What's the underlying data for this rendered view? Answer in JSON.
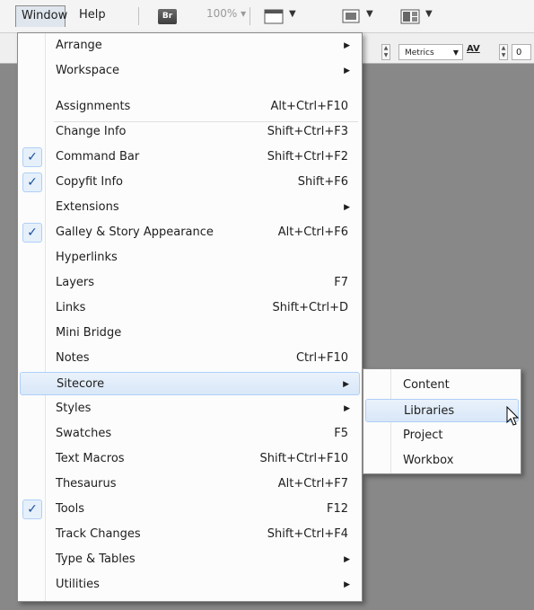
{
  "menubar": {
    "items": [
      {
        "label": "Window"
      },
      {
        "label": "Help"
      }
    ],
    "bridge_label": "Br",
    "zoom": "100%"
  },
  "controlbar": {
    "tracking_mode": "Metrics",
    "kern_label": "AV",
    "kern_value": "0"
  },
  "window_menu": {
    "items": [
      {
        "label": "Arrange",
        "shortcut": "",
        "submenu": true,
        "checked": false
      },
      {
        "label": "Workspace",
        "shortcut": "",
        "submenu": true,
        "checked": false
      },
      {
        "label": "Assignments",
        "shortcut": "Alt+Ctrl+F10",
        "submenu": false,
        "checked": false
      },
      {
        "label": "Change Info",
        "shortcut": "Shift+Ctrl+F3",
        "submenu": false,
        "checked": false
      },
      {
        "label": "Command Bar",
        "shortcut": "Shift+Ctrl+F2",
        "submenu": false,
        "checked": true
      },
      {
        "label": "Copyfit Info",
        "shortcut": "Shift+F6",
        "submenu": false,
        "checked": true
      },
      {
        "label": "Extensions",
        "shortcut": "",
        "submenu": true,
        "checked": false
      },
      {
        "label": "Galley & Story Appearance",
        "shortcut": "Alt+Ctrl+F6",
        "submenu": false,
        "checked": true
      },
      {
        "label": "Hyperlinks",
        "shortcut": "",
        "submenu": false,
        "checked": false
      },
      {
        "label": "Layers",
        "shortcut": "F7",
        "submenu": false,
        "checked": false
      },
      {
        "label": "Links",
        "shortcut": "Shift+Ctrl+D",
        "submenu": false,
        "checked": false
      },
      {
        "label": "Mini Bridge",
        "shortcut": "",
        "submenu": false,
        "checked": false
      },
      {
        "label": "Notes",
        "shortcut": "Ctrl+F10",
        "submenu": false,
        "checked": false
      },
      {
        "label": "Sitecore",
        "shortcut": "",
        "submenu": true,
        "checked": false,
        "highlighted": true
      },
      {
        "label": "Styles",
        "shortcut": "",
        "submenu": true,
        "checked": false
      },
      {
        "label": "Swatches",
        "shortcut": "F5",
        "submenu": false,
        "checked": false
      },
      {
        "label": "Text Macros",
        "shortcut": "Shift+Ctrl+F10",
        "submenu": false,
        "checked": false
      },
      {
        "label": "Thesaurus",
        "shortcut": "Alt+Ctrl+F7",
        "submenu": false,
        "checked": false
      },
      {
        "label": "Tools",
        "shortcut": "F12",
        "submenu": false,
        "checked": true
      },
      {
        "label": "Track Changes",
        "shortcut": "Shift+Ctrl+F4",
        "submenu": false,
        "checked": false
      },
      {
        "label": "Type & Tables",
        "shortcut": "",
        "submenu": true,
        "checked": false
      },
      {
        "label": "Utilities",
        "shortcut": "",
        "submenu": true,
        "checked": false
      }
    ]
  },
  "sitecore_submenu": {
    "items": [
      {
        "label": "Content"
      },
      {
        "label": "Libraries",
        "highlighted": true
      },
      {
        "label": "Project"
      },
      {
        "label": "Workbox"
      }
    ]
  },
  "icons": {
    "check": "checkmark-icon",
    "submenu_arrow": "submenu-arrow-icon",
    "cursor": "mouse-pointer-icon"
  },
  "colors": {
    "highlight_border": "#aecff7",
    "check_color": "#1a4f9c",
    "workspace_gray": "#888888"
  }
}
